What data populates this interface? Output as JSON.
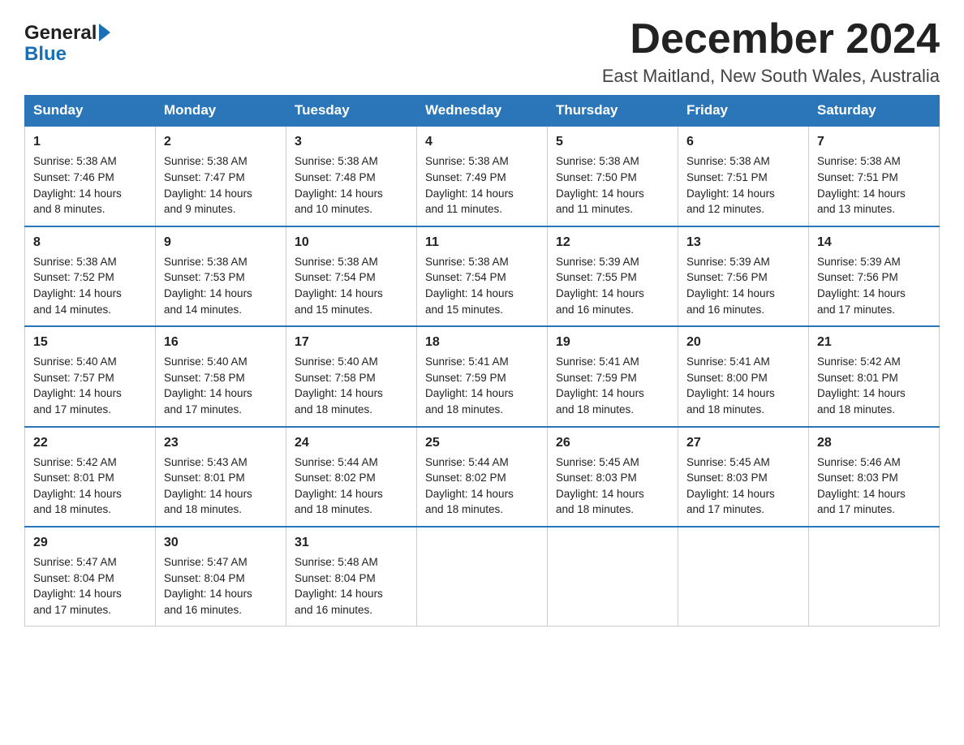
{
  "logo": {
    "text_general": "General",
    "text_blue": "Blue",
    "arrow": "▶"
  },
  "header": {
    "month_title": "December 2024",
    "location": "East Maitland, New South Wales, Australia"
  },
  "weekdays": [
    "Sunday",
    "Monday",
    "Tuesday",
    "Wednesday",
    "Thursday",
    "Friday",
    "Saturday"
  ],
  "weeks": [
    [
      {
        "day": "1",
        "sunrise": "5:38 AM",
        "sunset": "7:46 PM",
        "daylight": "14 hours and 8 minutes."
      },
      {
        "day": "2",
        "sunrise": "5:38 AM",
        "sunset": "7:47 PM",
        "daylight": "14 hours and 9 minutes."
      },
      {
        "day": "3",
        "sunrise": "5:38 AM",
        "sunset": "7:48 PM",
        "daylight": "14 hours and 10 minutes."
      },
      {
        "day": "4",
        "sunrise": "5:38 AM",
        "sunset": "7:49 PM",
        "daylight": "14 hours and 11 minutes."
      },
      {
        "day": "5",
        "sunrise": "5:38 AM",
        "sunset": "7:50 PM",
        "daylight": "14 hours and 11 minutes."
      },
      {
        "day": "6",
        "sunrise": "5:38 AM",
        "sunset": "7:51 PM",
        "daylight": "14 hours and 12 minutes."
      },
      {
        "day": "7",
        "sunrise": "5:38 AM",
        "sunset": "7:51 PM",
        "daylight": "14 hours and 13 minutes."
      }
    ],
    [
      {
        "day": "8",
        "sunrise": "5:38 AM",
        "sunset": "7:52 PM",
        "daylight": "14 hours and 14 minutes."
      },
      {
        "day": "9",
        "sunrise": "5:38 AM",
        "sunset": "7:53 PM",
        "daylight": "14 hours and 14 minutes."
      },
      {
        "day": "10",
        "sunrise": "5:38 AM",
        "sunset": "7:54 PM",
        "daylight": "14 hours and 15 minutes."
      },
      {
        "day": "11",
        "sunrise": "5:38 AM",
        "sunset": "7:54 PM",
        "daylight": "14 hours and 15 minutes."
      },
      {
        "day": "12",
        "sunrise": "5:39 AM",
        "sunset": "7:55 PM",
        "daylight": "14 hours and 16 minutes."
      },
      {
        "day": "13",
        "sunrise": "5:39 AM",
        "sunset": "7:56 PM",
        "daylight": "14 hours and 16 minutes."
      },
      {
        "day": "14",
        "sunrise": "5:39 AM",
        "sunset": "7:56 PM",
        "daylight": "14 hours and 17 minutes."
      }
    ],
    [
      {
        "day": "15",
        "sunrise": "5:40 AM",
        "sunset": "7:57 PM",
        "daylight": "14 hours and 17 minutes."
      },
      {
        "day": "16",
        "sunrise": "5:40 AM",
        "sunset": "7:58 PM",
        "daylight": "14 hours and 17 minutes."
      },
      {
        "day": "17",
        "sunrise": "5:40 AM",
        "sunset": "7:58 PM",
        "daylight": "14 hours and 18 minutes."
      },
      {
        "day": "18",
        "sunrise": "5:41 AM",
        "sunset": "7:59 PM",
        "daylight": "14 hours and 18 minutes."
      },
      {
        "day": "19",
        "sunrise": "5:41 AM",
        "sunset": "7:59 PM",
        "daylight": "14 hours and 18 minutes."
      },
      {
        "day": "20",
        "sunrise": "5:41 AM",
        "sunset": "8:00 PM",
        "daylight": "14 hours and 18 minutes."
      },
      {
        "day": "21",
        "sunrise": "5:42 AM",
        "sunset": "8:01 PM",
        "daylight": "14 hours and 18 minutes."
      }
    ],
    [
      {
        "day": "22",
        "sunrise": "5:42 AM",
        "sunset": "8:01 PM",
        "daylight": "14 hours and 18 minutes."
      },
      {
        "day": "23",
        "sunrise": "5:43 AM",
        "sunset": "8:01 PM",
        "daylight": "14 hours and 18 minutes."
      },
      {
        "day": "24",
        "sunrise": "5:44 AM",
        "sunset": "8:02 PM",
        "daylight": "14 hours and 18 minutes."
      },
      {
        "day": "25",
        "sunrise": "5:44 AM",
        "sunset": "8:02 PM",
        "daylight": "14 hours and 18 minutes."
      },
      {
        "day": "26",
        "sunrise": "5:45 AM",
        "sunset": "8:03 PM",
        "daylight": "14 hours and 18 minutes."
      },
      {
        "day": "27",
        "sunrise": "5:45 AM",
        "sunset": "8:03 PM",
        "daylight": "14 hours and 17 minutes."
      },
      {
        "day": "28",
        "sunrise": "5:46 AM",
        "sunset": "8:03 PM",
        "daylight": "14 hours and 17 minutes."
      }
    ],
    [
      {
        "day": "29",
        "sunrise": "5:47 AM",
        "sunset": "8:04 PM",
        "daylight": "14 hours and 17 minutes."
      },
      {
        "day": "30",
        "sunrise": "5:47 AM",
        "sunset": "8:04 PM",
        "daylight": "14 hours and 16 minutes."
      },
      {
        "day": "31",
        "sunrise": "5:48 AM",
        "sunset": "8:04 PM",
        "daylight": "14 hours and 16 minutes."
      },
      null,
      null,
      null,
      null
    ]
  ]
}
